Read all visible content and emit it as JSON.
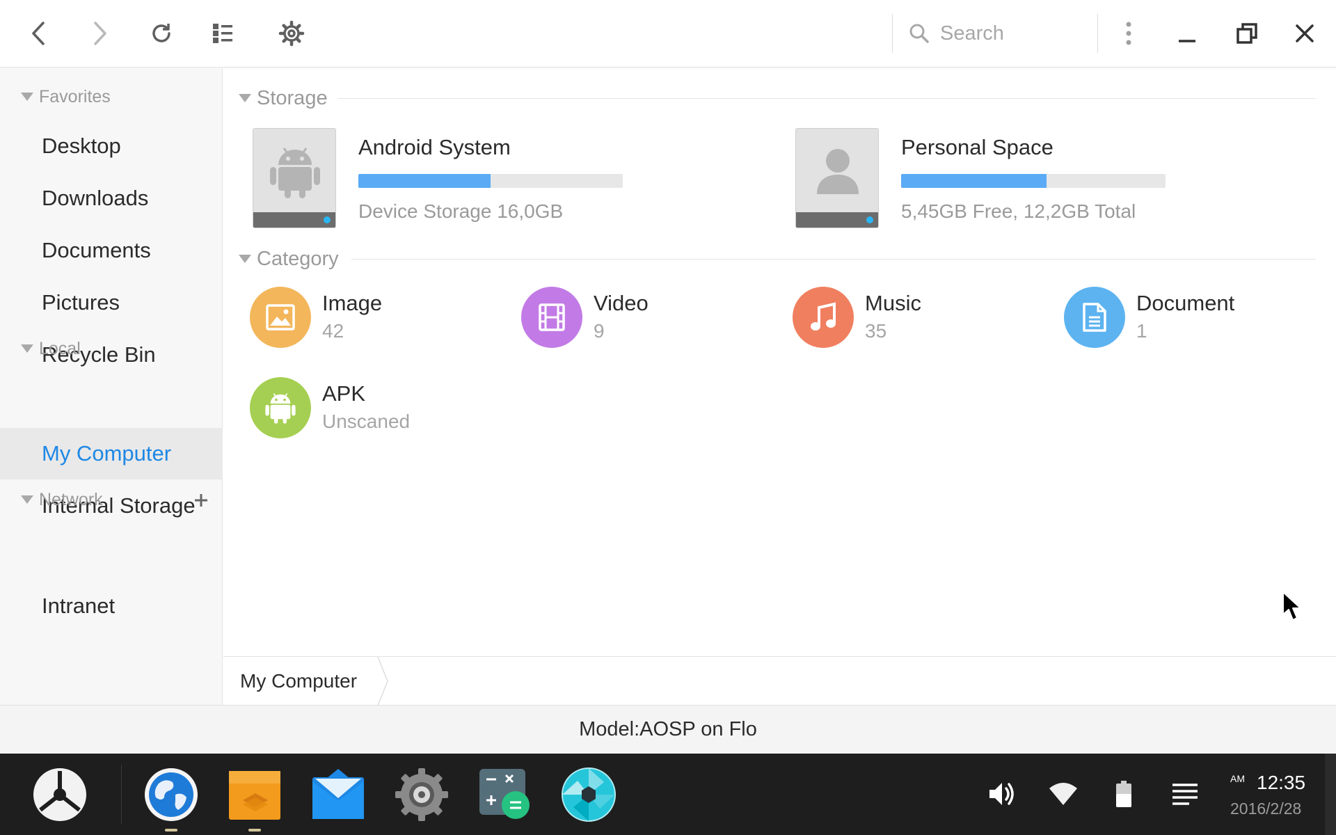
{
  "toolbar": {
    "search_placeholder": "Search"
  },
  "sidebar": {
    "favorites_label": "Favorites",
    "favorites": [
      {
        "label": "Desktop"
      },
      {
        "label": "Downloads"
      },
      {
        "label": "Documents"
      },
      {
        "label": "Pictures"
      },
      {
        "label": "Recycle Bin"
      }
    ],
    "local_label": "Local",
    "local": [
      {
        "label": "My Computer",
        "active": true
      },
      {
        "label": "Internal Storage"
      }
    ],
    "network_label": "Network",
    "network": [
      {
        "label": "Intranet"
      }
    ]
  },
  "main": {
    "storage_label": "Storage",
    "drives": [
      {
        "name": "Android System",
        "info": "Device Storage 16,0GB",
        "usage_fraction": 0.5,
        "icon": "android-icon"
      },
      {
        "name": "Personal Space",
        "info": "5,45GB Free, 12,2GB Total",
        "usage_fraction": 0.55,
        "icon": "user-icon"
      }
    ],
    "category_label": "Category",
    "categories": [
      {
        "name": "Image",
        "count": "42",
        "color": "#F3B65B",
        "icon": "image-icon"
      },
      {
        "name": "Video",
        "count": "9",
        "color": "#C27BE6",
        "icon": "film-icon"
      },
      {
        "name": "Music",
        "count": "35",
        "color": "#F07F5F",
        "icon": "music-note-icon"
      },
      {
        "name": "Document",
        "count": "1",
        "color": "#5CB3F0",
        "icon": "document-icon"
      },
      {
        "name": "APK",
        "count": "Unscaned",
        "color": "#A5CF52",
        "icon": "android-icon"
      }
    ]
  },
  "breadcrumb": {
    "current": "My Computer"
  },
  "status": {
    "model": "Model:AOSP on Flo"
  },
  "taskbar": {
    "apps": [
      "start-menu",
      "browser",
      "file-manager",
      "email",
      "settings",
      "calculator",
      "camera"
    ],
    "clock": {
      "ampm": "AM",
      "time": "12:35",
      "date": "2016/2/28"
    }
  },
  "colors": {
    "accent": "#1E88E5",
    "progress": "#5AAAF5",
    "taskbar": "#1E1E1E"
  }
}
